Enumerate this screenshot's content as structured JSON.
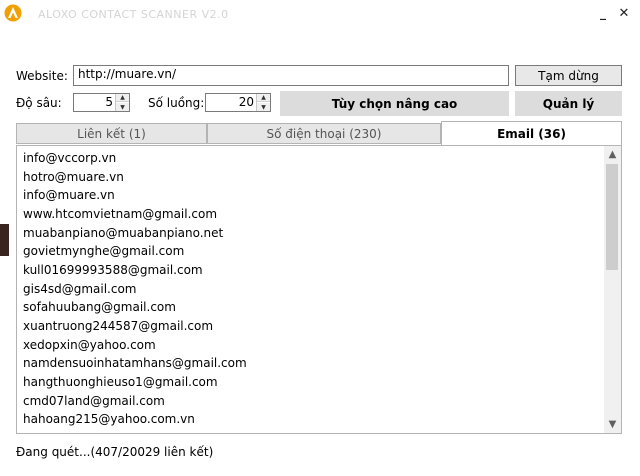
{
  "window": {
    "title": "ALOXO CONTACT SCANNER V2.0",
    "minimize_label": "_",
    "close_label": "✕",
    "logo_icon": "aloxo-logo-icon",
    "accent": "#f0a000"
  },
  "form": {
    "website_label": "Website:",
    "website_value": "http://muare.vn/",
    "pause_button": "Tạm dừng",
    "depth_label": "Độ sâu:",
    "depth_value": "5",
    "threads_label": "Số luồng:",
    "threads_value": "20",
    "advanced_button": "Tùy  chọn  nâng  cao",
    "manage_button": "Quản   lý"
  },
  "tabs": [
    {
      "label": "Liên kết (1)",
      "active": false
    },
    {
      "label": "Số điện thoại (230)",
      "active": false
    },
    {
      "label": "Email (36)",
      "active": true
    }
  ],
  "emails": [
    "info@vccorp.vn",
    "hotro@muare.vn",
    "info@muare.vn",
    "www.htcomvietnam@gmail.com",
    "muabanpiano@muabanpiano.net",
    "govietmynghe@gmail.com",
    "kull01699993588@gmail.com",
    "gis4sd@gmail.com",
    "sofahuubang@gmail.com",
    "xuantruong244587@gmail.com",
    "xedopxin@yahoo.com",
    "namdensuoinhatamhans@gmail.com",
    "hangthuonghieuso1@gmail.com",
    "cmd07land@gmail.com",
    "hahoang215@yahoo.com.vn"
  ],
  "status": "Đang quét...(407/20029 liên kết)"
}
